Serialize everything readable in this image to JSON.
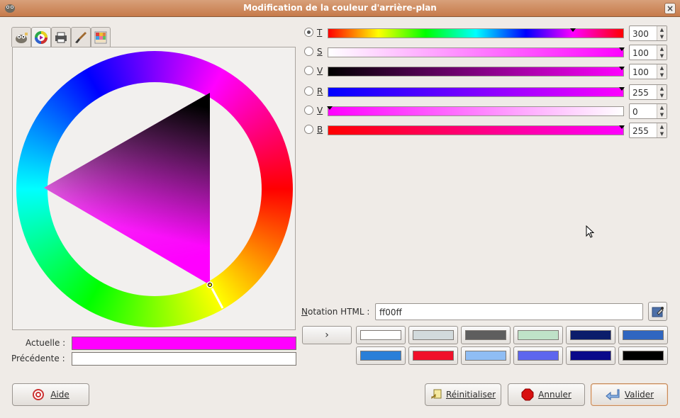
{
  "window": {
    "title": "Modification de la couleur d'arrière-plan"
  },
  "tabs": [
    {
      "name": "gimp",
      "icon": "gimp-icon"
    },
    {
      "name": "wheel",
      "icon": "color-wheel-icon"
    },
    {
      "name": "printer",
      "icon": "printer-icon"
    },
    {
      "name": "brush",
      "icon": "brush-icon"
    },
    {
      "name": "palette",
      "icon": "palette-icon"
    }
  ],
  "swatches": {
    "current_label": "Actuelle :",
    "previous_label": "Précédente :",
    "current_color": "#ff00ff",
    "previous_color": "#ffffff"
  },
  "channels": [
    {
      "label": "T",
      "value": "300",
      "selected": true
    },
    {
      "label": "S",
      "value": "100",
      "selected": false
    },
    {
      "label": "V",
      "value": "100",
      "selected": false
    },
    {
      "label": "R",
      "value": "255",
      "selected": false
    },
    {
      "label": "V",
      "value": "0",
      "selected": false
    },
    {
      "label": "B",
      "value": "255",
      "selected": false
    }
  ],
  "html_notation": {
    "label": "Notation HTML :",
    "value": "ff00ff"
  },
  "history_button": {
    "label": "›"
  },
  "history_colors": [
    "#ffffff",
    "#d2dadc",
    "#5e5e5e",
    "#bfe2c8",
    "#0b1d6b",
    "#3066c0",
    "#2a7fd8",
    "#f0102a",
    "#8fbdf4",
    "#5d66ee",
    "#0a0a8a",
    "#000000"
  ],
  "buttons": {
    "help": "Aide",
    "reset": "Réinitialiser",
    "cancel": "Annuler",
    "ok": "Valider"
  }
}
